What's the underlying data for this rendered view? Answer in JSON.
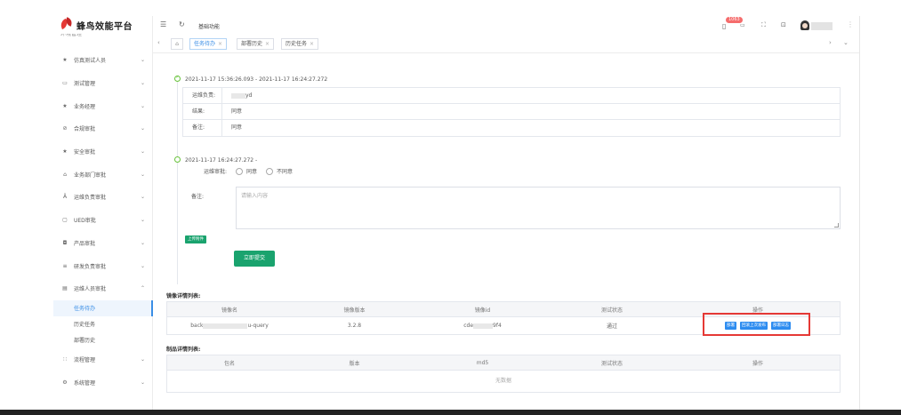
{
  "app": {
    "logo_text": "蜂鸟效能平台",
    "cut_item": "环境管理"
  },
  "sidebar": {
    "items": [
      {
        "icon": "star-icon",
        "glyph": "★",
        "label": "仿真测试人员"
      },
      {
        "icon": "monitor-icon",
        "glyph": "▭",
        "label": "测试管理"
      },
      {
        "icon": "star-icon",
        "glyph": "★",
        "label": "业务经理"
      },
      {
        "icon": "shield-icon",
        "glyph": "⊘",
        "label": "合规审批"
      },
      {
        "icon": "star-icon",
        "glyph": "★",
        "label": "安全审批"
      },
      {
        "icon": "building-icon",
        "glyph": "⌂",
        "label": "业务部门审批"
      },
      {
        "icon": "user-icon",
        "glyph": "Ä",
        "label": "运维负责审批"
      },
      {
        "icon": "doc-icon",
        "glyph": "▢",
        "label": "UED审批"
      },
      {
        "icon": "cart-icon",
        "glyph": "◘",
        "label": "产品审批"
      },
      {
        "icon": "list-icon",
        "glyph": "≡",
        "label": "研发负责审批"
      },
      {
        "icon": "doc-icon",
        "glyph": "▤",
        "label": "运维人员审批"
      }
    ],
    "sub_items": [
      {
        "label": "任务待办",
        "active": true
      },
      {
        "label": "历史任务",
        "active": false
      },
      {
        "label": "部署历史",
        "active": false
      }
    ],
    "bottom_items": [
      {
        "icon": "flow-icon",
        "glyph": "∷",
        "label": "流程管理"
      },
      {
        "icon": "gear-icon",
        "glyph": "⚙",
        "label": "系统管理"
      }
    ]
  },
  "header": {
    "breadcrumb": "基础功能",
    "badge": "1063"
  },
  "tabs": [
    {
      "label": "任务待办",
      "active": true
    },
    {
      "label": "部署历史",
      "active": false
    },
    {
      "label": "历史任务",
      "active": false
    }
  ],
  "timeline": {
    "done_title": "2021-11-17 15:36:26.093 - 2021-11-17 16:24:27.272",
    "info": [
      {
        "key": "运维负责:",
        "value": "yd"
      },
      {
        "key": "结果:",
        "value": "同意"
      },
      {
        "key": "备注:",
        "value": "同意"
      }
    ],
    "pending_title": "2021-11-17 16:24:27.272 -",
    "approval_label": "运维审批:",
    "agree": "同意",
    "disagree": "不同意",
    "remark_label": "备注:",
    "remark_placeholder": "请输入内容",
    "upload_label": "上传附件",
    "submit_label": "立即提交"
  },
  "image_table": {
    "title": "镜像详情列表:",
    "columns": [
      "镜像名",
      "镜像版本",
      "镜像id",
      "测试状态",
      "操作"
    ],
    "row": {
      "name_start": "back",
      "name_end": "u-query",
      "version": "3.2.8",
      "id_start": "cde",
      "id_end": "9f4",
      "status": "通过"
    },
    "actions": [
      "部署",
      "回滚上次发布",
      "部署日志"
    ]
  },
  "artifact_table": {
    "title": "制品详情列表:",
    "columns": [
      "包名",
      "版本",
      "md5",
      "测试状态",
      "操作"
    ],
    "empty": "无数据"
  }
}
